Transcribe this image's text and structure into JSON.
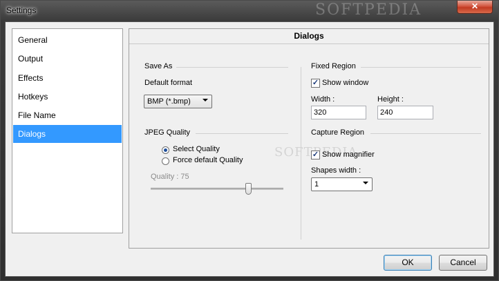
{
  "window": {
    "title": "Settings",
    "watermark": "SOFTPEDIA",
    "close_label": "✕"
  },
  "sidebar": {
    "items": [
      {
        "label": "General"
      },
      {
        "label": "Output"
      },
      {
        "label": "Effects"
      },
      {
        "label": "Hotkeys"
      },
      {
        "label": "File Name"
      },
      {
        "label": "Dialogs",
        "selected": true
      }
    ]
  },
  "panel": {
    "title": "Dialogs",
    "save_as": {
      "group_label": "Save As",
      "default_format_label": "Default format",
      "default_format_value": "BMP (*.bmp)"
    },
    "jpeg_quality": {
      "group_label": "JPEG Quality",
      "select_quality_label": "Select Quality",
      "force_default_label": "Force default Quality",
      "selected_option": "Select Quality",
      "quality_label": "Quality : 75",
      "quality_value": 75,
      "watermark": "SOFTPEDIA"
    },
    "fixed_region": {
      "group_label": "Fixed Region",
      "show_window_label": "Show window",
      "show_window_checked": true,
      "width_label": "Width :",
      "width_value": "320",
      "height_label": "Height :",
      "height_value": "240"
    },
    "capture_region": {
      "group_label": "Capture Region",
      "show_magnifier_label": "Show magnifier",
      "show_magnifier_checked": true,
      "shapes_width_label": "Shapes width :",
      "shapes_width_value": "1"
    }
  },
  "buttons": {
    "ok_label": "OK",
    "cancel_label": "Cancel"
  },
  "colors": {
    "selection": "#3399ff",
    "close_button": "#c23a22",
    "ok_border": "#3c7fb1"
  }
}
